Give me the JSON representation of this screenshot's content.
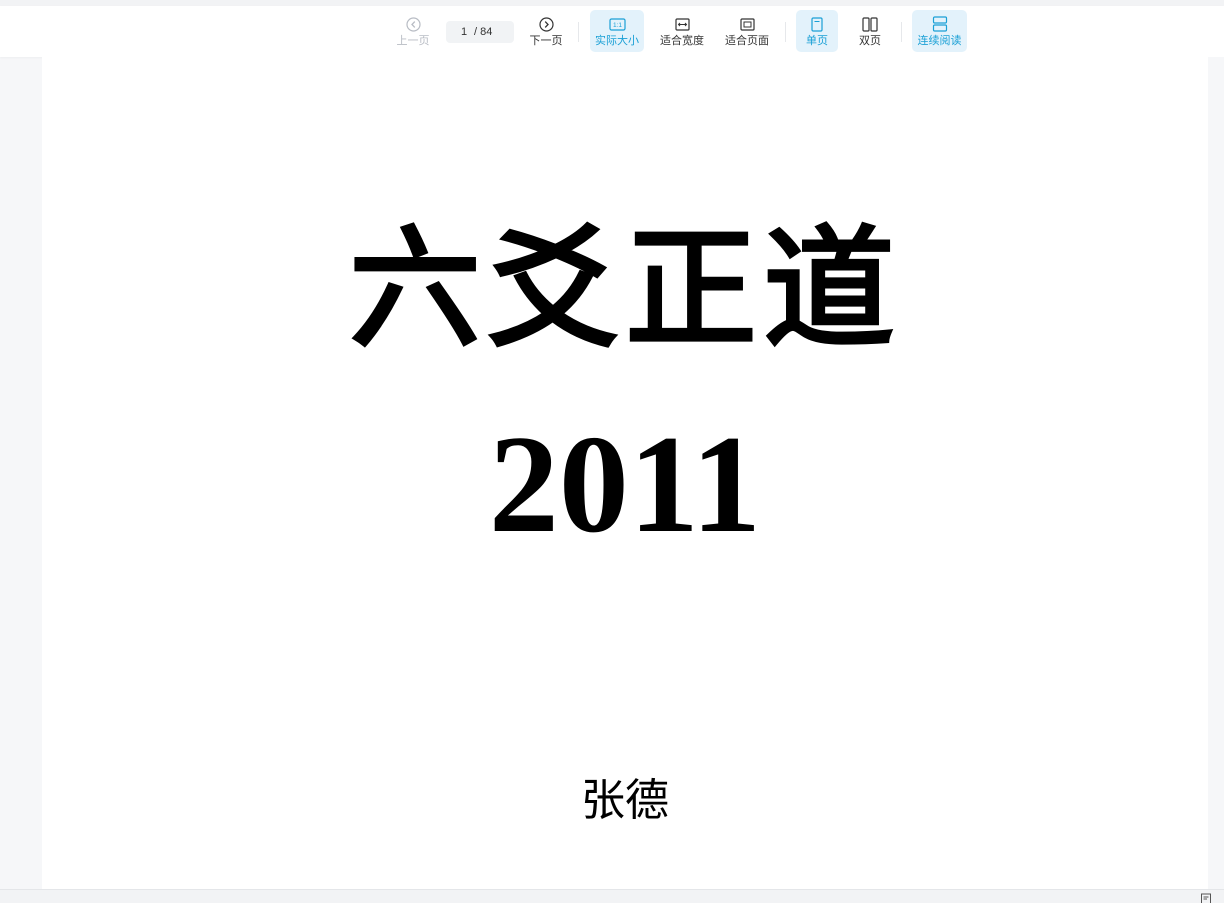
{
  "toolbar": {
    "prev_label": "上一页",
    "next_label": "下一页",
    "current_page": "1",
    "total_pages": "/ 84",
    "actual_size_label": "实际大小",
    "fit_width_label": "适合宽度",
    "fit_page_label": "适合页面",
    "single_page_label": "单页",
    "double_page_label": "双页",
    "continuous_label": "连续阅读",
    "actual_size_icon_text": "1:1"
  },
  "icons": {
    "prev": "circle-chevron-left-icon",
    "next": "circle-chevron-right-icon",
    "actual_size": "one-to-one-icon",
    "fit_width": "fit-width-icon",
    "fit_page": "fit-page-icon",
    "single_page": "single-page-icon",
    "double_page": "double-page-icon",
    "continuous": "continuous-scroll-icon",
    "status": "document-outline-icon"
  },
  "colors": {
    "accent": "#1aa0d6",
    "active_bg": "#e3f2fb",
    "disabled": "#b8bcc4"
  },
  "document": {
    "title": "六爻正道",
    "year": "2011",
    "author": "张德"
  }
}
